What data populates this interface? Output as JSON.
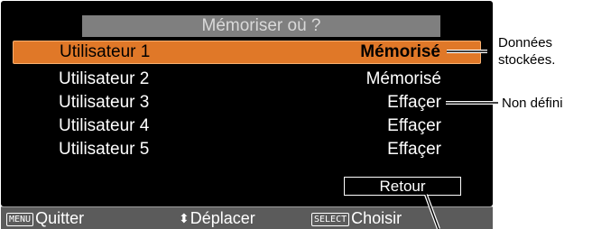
{
  "menu": {
    "title": "Mémoriser où ?",
    "rows": [
      {
        "name": "Utilisateur 1",
        "status": "Mémorisé"
      },
      {
        "name": "Utilisateur 2",
        "status": "Mémorisé"
      },
      {
        "name": "Utilisateur 3",
        "status": "Effaçer"
      },
      {
        "name": "Utilisateur 4",
        "status": "Effaçer"
      },
      {
        "name": "Utilisateur 5",
        "status": "Effaçer"
      }
    ],
    "selected_index": 0,
    "retour_label": "Retour"
  },
  "bottom_bar": {
    "menu_key": "MENU",
    "menu_label": "Quitter",
    "move_icon": "up-down-arrow-icon",
    "move_label": "Déplacer",
    "select_key": "SELECT",
    "select_label": "Choisir"
  },
  "callouts": {
    "stored_line1": "Données",
    "stored_line2": "stockées.",
    "undefined": "Non défini"
  },
  "colors": {
    "osd_background": "#000000",
    "title_bar": "#7f7f7f",
    "selected_row": "#e07828",
    "bottom_bar": "#5b5b5b"
  }
}
